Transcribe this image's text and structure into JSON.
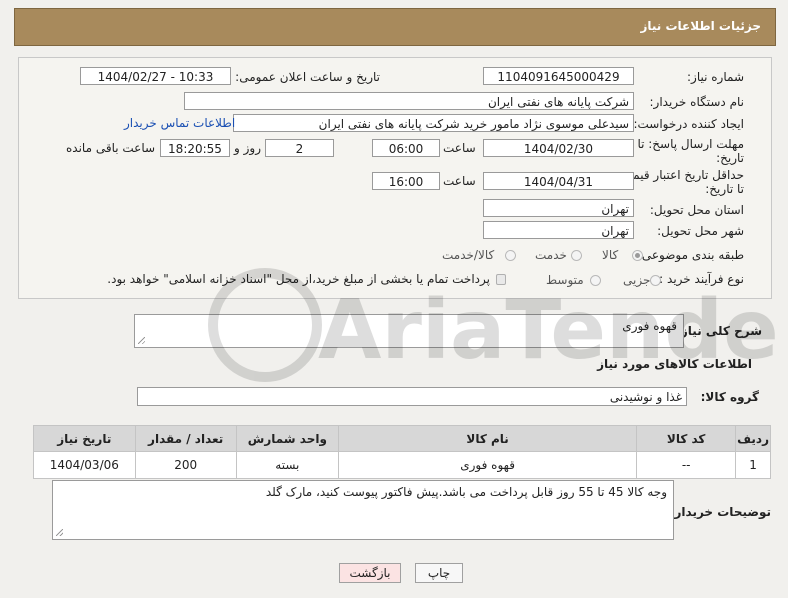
{
  "header": {
    "title": "جزئیات اطلاعات نیاز"
  },
  "fields": {
    "need_number_label": "شماره نیاز:",
    "need_number": "1104091645000429",
    "announce_label": "تاریخ و ساعت اعلان عمومی:",
    "announce_value": "1404/02/27 - 10:33",
    "buyer_org_label": "نام دستگاه خریدار:",
    "buyer_org": "شرکت پایانه های نفتی ایران",
    "requester_label": "ایجاد کننده درخواست:",
    "requester": "سیدعلی موسوی نژاد مامور خرید شرکت پایانه های نفتی ایران",
    "contact_link": "اطلاعات تماس خریدار",
    "deadline_label_1": "مهلت ارسال پاسخ: تا",
    "deadline_label_2": "تاریخ:",
    "deadline_date": "1404/02/30",
    "time_label": "ساعت",
    "deadline_time": "06:00",
    "days_value": "2",
    "days_label": "روز و",
    "remaining_time": "18:20:55",
    "remaining_label": "ساعت باقی مانده",
    "validity_label_1": "حداقل تاریخ اعتبار قیمت:",
    "validity_label_2": "تا تاریخ:",
    "validity_date": "1404/04/31",
    "validity_time": "16:00",
    "province_label": "استان محل تحویل:",
    "province": "تهران",
    "city_label": "شهر محل تحویل:",
    "city": "تهران",
    "category_label": "طبقه بندی موضوعی:",
    "category_options": [
      "کالا",
      "خدمت",
      "کالا/خدمت"
    ],
    "category_selected": "کالا",
    "purchase_type_label": "نوع فرآیند خرید :",
    "purchase_options": [
      "جزیی",
      "متوسط"
    ],
    "payment_note": "پرداخت تمام یا بخشی از مبلغ خرید،از محل \"اسناد خزانه اسلامی\" خواهد بود."
  },
  "description": {
    "label": "شرح کلی نیاز:",
    "value": "قهوه فوری"
  },
  "goods": {
    "section_title": "اطلاعات کالاهای مورد نیاز",
    "group_label": "گروه کالا:",
    "group_value": "غذا و نوشیدنی"
  },
  "table": {
    "headers": [
      "ردیف",
      "کد کالا",
      "نام کالا",
      "واحد شمارش",
      "تعداد / مقدار",
      "تاریخ نیاز"
    ],
    "rows": [
      [
        "1",
        "--",
        "قهوه فوری",
        "بسته",
        "200",
        "1404/03/06"
      ]
    ]
  },
  "buyer_notes": {
    "label": "توضیحات خریدار:",
    "value": "وجه کالا 45 تا 55 روز قابل پرداخت می باشد.پیش فاکتور پیوست کنید، مارک گلد"
  },
  "buttons": {
    "print": "چاپ",
    "back": "بازگشت"
  },
  "watermark": {
    "text": "AriaTender.net"
  },
  "colors": {
    "header": "#a88a5c",
    "link": "#1a4fb3",
    "back_button": "#fbe3e3"
  }
}
